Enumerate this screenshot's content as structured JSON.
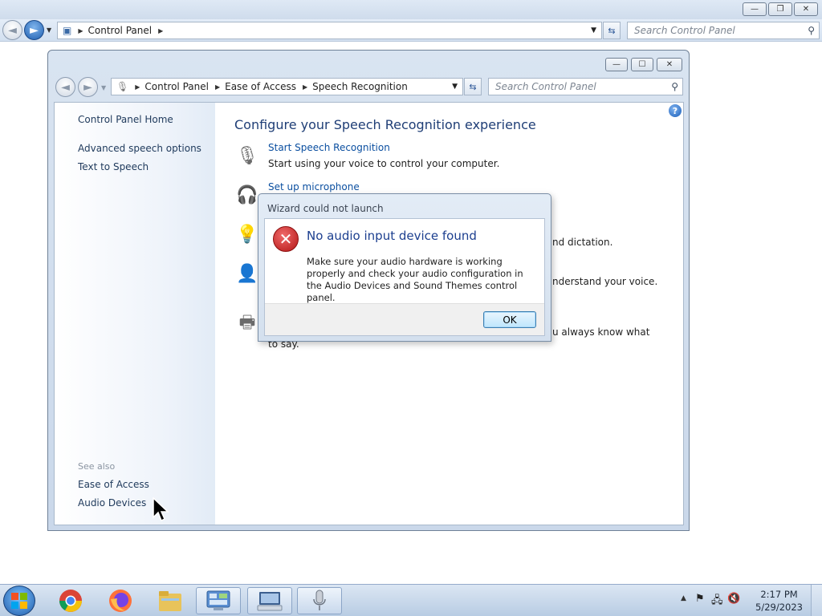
{
  "outer_window": {
    "address": {
      "segments": [
        "Control Panel"
      ]
    },
    "search_placeholder": "Search Control Panel"
  },
  "inner_window": {
    "address": {
      "segments": [
        "Control Panel",
        "Ease of Access",
        "Speech Recognition"
      ]
    },
    "search_placeholder": "Search Control Panel",
    "left_pane": {
      "home_link": "Control Panel Home",
      "links": [
        "Advanced speech options",
        "Text to Speech"
      ],
      "see_also_label": "See also",
      "see_also": [
        "Ease of Access",
        "Audio Devices"
      ]
    },
    "main": {
      "title": "Configure your Speech Recognition experience",
      "tasks": [
        {
          "icon": "microphone-icon",
          "link": "Start Speech Recognition",
          "desc": "Start using your voice to control your computer."
        },
        {
          "icon": "headset-icon",
          "link": "Set up microphone",
          "desc": ""
        },
        {
          "icon": "lightbulb-icon",
          "link": "",
          "desc": "nd dictation."
        },
        {
          "icon": "person-icon",
          "link": "",
          "desc": "nderstand your voice."
        },
        {
          "icon": "printer-icon",
          "link": "",
          "desc": "u always know what to say."
        }
      ]
    }
  },
  "dialog": {
    "title": "Wizard could not launch",
    "heading": "No audio input device found",
    "message": "Make sure your audio hardware is working properly and check your audio configuration in the Audio Devices and Sound Themes control panel.",
    "ok_label": "OK"
  },
  "taskbar": {
    "apps": [
      "chrome-icon",
      "firefox-icon",
      "file-explorer-icon",
      "control-panel-icon",
      "keyboard-icon",
      "microphone-icon"
    ],
    "clock": {
      "time": "2:17 PM",
      "date": "5/29/2023"
    }
  },
  "colors": {
    "link": "#0b4fa0",
    "title_blue": "#1f3e76",
    "dialog_heading": "#1c3f8f",
    "error_red": "#c01818"
  }
}
